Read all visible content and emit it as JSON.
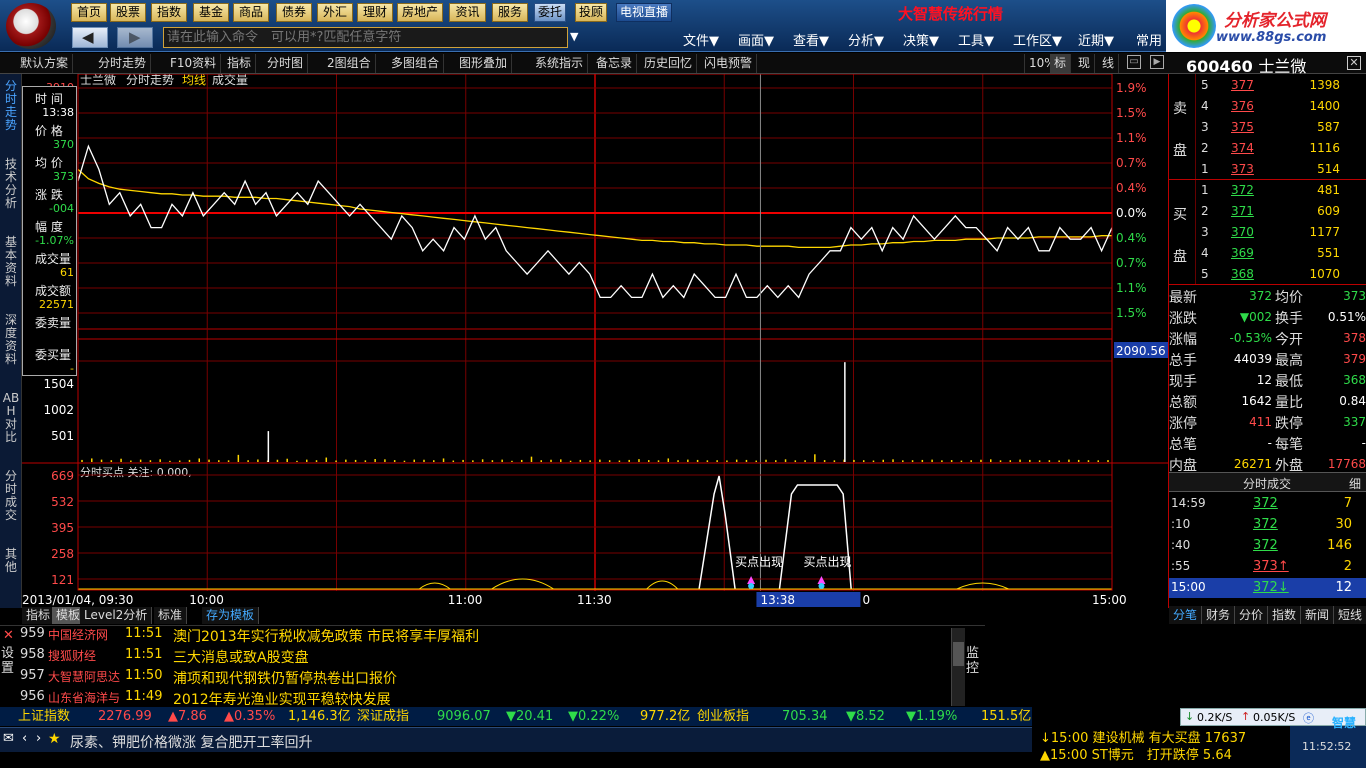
{
  "nav": {
    "buttons": [
      "首页",
      "股票",
      "指数",
      "基金",
      "商品",
      "债券",
      "外汇",
      "理财",
      "房地产",
      "资讯",
      "服务",
      "委托",
      "投顾",
      "电视直播"
    ],
    "brand": "大智慧传统行情",
    "command_placeholder": "请在此输入命令　可以用*?匹配任意字符",
    "menus": [
      "文件▼",
      "画面▼",
      "查看▼",
      "分析▼",
      "决策▼",
      "工具▼",
      "工作区▼",
      "近期▼",
      "常用"
    ],
    "site_logo_title": "分析家公式网",
    "site_logo_url": "www.88gs.com"
  },
  "toolbar": {
    "tabs": [
      "默认方案",
      "分时走势",
      "F10资料",
      "指标",
      "分时图",
      "2图组合",
      "多图组合",
      "图形叠加",
      "系统指示",
      "备忘录",
      "历史回忆",
      "闪电预警"
    ],
    "zoom": "10%",
    "modes": [
      "标",
      "现",
      "线"
    ]
  },
  "stock": {
    "code": "600460",
    "name": "士兰微"
  },
  "left_tabs": [
    "分时走势",
    "技术分析",
    "基本资料",
    "深度资料",
    "ABH对比",
    "分时成交",
    "其他"
  ],
  "chart_header": {
    "name": "士兰微",
    "items": [
      "分时走势",
      "均线",
      "成交量"
    ]
  },
  "info_box": {
    "rows": [
      {
        "label": "时 间",
        "value": "13:38",
        "color": "white"
      },
      {
        "label": "价 格",
        "value": "370",
        "color": "green"
      },
      {
        "label": "均 价",
        "value": "373",
        "color": "green"
      },
      {
        "label": "涨 跌",
        "value": "-004",
        "color": "green"
      },
      {
        "label": "幅 度",
        "value": "-1.07%",
        "color": "green"
      },
      {
        "label": "成交量",
        "value": "61",
        "color": "yellow"
      },
      {
        "label": "成交额",
        "value": "22571",
        "color": "yellow"
      },
      {
        "label": "委卖量",
        "value": "",
        "color": "yellow"
      },
      {
        "label": "委买量",
        "value": "-",
        "color": "yellow"
      }
    ]
  },
  "chart_data": [
    {
      "type": "line",
      "title": "",
      "series": [
        {
          "name": "",
          "values": [
            376,
            379,
            377,
            374,
            375,
            373,
            374,
            372,
            372,
            374,
            373,
            375,
            373,
            374,
            375,
            374,
            376,
            374,
            375,
            373,
            374,
            375,
            374,
            376,
            375,
            374,
            373,
            374,
            373,
            372,
            371,
            373,
            372,
            370,
            371,
            370,
            372,
            371,
            373,
            371,
            372,
            370,
            369,
            368,
            369,
            370,
            369,
            368,
            369,
            368,
            366,
            366,
            367,
            366,
            366,
            368,
            366,
            367,
            366,
            368,
            367,
            366,
            366,
            368,
            366,
            366,
            367,
            366,
            367,
            366,
            368,
            369,
            370,
            370,
            372,
            371,
            372,
            370,
            372,
            371,
            373,
            372,
            371,
            372,
            373,
            372,
            372,
            371,
            370,
            372,
            371,
            372,
            370,
            370,
            372,
            371,
            371,
            372,
            370,
            372
          ]
        },
        {
          "name": "",
          "values": [
            377,
            376.2,
            375.8,
            375.5,
            375.3,
            375.2,
            375.1,
            375,
            374.9,
            374.9,
            374.8,
            374.8,
            374.7,
            374.7,
            374.7,
            374.6,
            374.6,
            374.6,
            374.5,
            374.5,
            374.4,
            374.3,
            374.2,
            374.1,
            374,
            373.9,
            373.8,
            373.6,
            373.5,
            373.4,
            373.3,
            373.2,
            373.1,
            373,
            372.9,
            372.8,
            372.7,
            372.6,
            372.5,
            372.4,
            372.3,
            372.2,
            372.1,
            372,
            371.9,
            371.8,
            371.7,
            371.6,
            371.5,
            371.4,
            371.3,
            371.2,
            371.1,
            371,
            370.9,
            370.9,
            370.8,
            370.8,
            370.7,
            370.7,
            370.6,
            370.6,
            370.5,
            370.5,
            370.5,
            370.4,
            370.4,
            370.4,
            370.4,
            370.3,
            370.3,
            370.3,
            370.3,
            370.4,
            370.5,
            370.5,
            370.6,
            370.6,
            370.7,
            370.7,
            370.8,
            370.8,
            370.9,
            370.9,
            370.9,
            371,
            371,
            371,
            371.1,
            371.1,
            371.1,
            371.1,
            371.2,
            371.2,
            371.2,
            371.2,
            371.2,
            371.2,
            371.3,
            371.3
          ]
        }
      ],
      "ylim": [
        365,
        384
      ],
      "right_axis_labels": [
        "1.9%",
        "1.5%",
        "1.1%",
        "0.7%",
        "0.4%",
        "0.0%",
        "0.4%",
        "0.7%",
        "1.1%",
        "1.5%"
      ],
      "left_axis_top": "3910",
      "cursor_value": "2090.56"
    },
    {
      "type": "bar",
      "title": "",
      "ylabels": [
        "1504",
        "1002",
        "501"
      ],
      "values": [
        35,
        60,
        40,
        30,
        55,
        25,
        40,
        30,
        45,
        20,
        25,
        35,
        60,
        40,
        30,
        28,
        120,
        30,
        42,
        25,
        38,
        55,
        20,
        40,
        30,
        75,
        25,
        40,
        35,
        28,
        50,
        45,
        32,
        22,
        40,
        38,
        30,
        60,
        25,
        35,
        28,
        45,
        30,
        40,
        20,
        35,
        90,
        30,
        38,
        44,
        22,
        35,
        28,
        40,
        30,
        25,
        35,
        48,
        32,
        28,
        60,
        30,
        40,
        35,
        28,
        30,
        26,
        40,
        35,
        24,
        38,
        30,
        45,
        28,
        30,
        130,
        32,
        28,
        40,
        35,
        30,
        25,
        38,
        45,
        28,
        30,
        35,
        40,
        28,
        32,
        24,
        30,
        38,
        45,
        28,
        30,
        40,
        35,
        28,
        30,
        26,
        40,
        35,
        30,
        28,
        32
      ],
      "spikes": [
        {
          "index": 75,
          "value": 1680
        },
        {
          "index": 16,
          "value": 520
        }
      ]
    },
    {
      "type": "area",
      "title": "",
      "legend": "分时买点 关注: 0.000,",
      "ylabels": [
        "669",
        "532",
        "395",
        "258",
        "121"
      ],
      "annotations": [
        "买点出现",
        "买点出现"
      ]
    }
  ],
  "time_axis": {
    "start": "2013/01/04, 09:30",
    "labels": [
      "10:00",
      "11:00",
      "11:30",
      "15:00"
    ],
    "cursor": "13:38",
    "cursor_value": "0"
  },
  "bottom_tabs": [
    "指标",
    "模板",
    "Level2分析",
    "标准",
    "存为模板"
  ],
  "order_book": {
    "sell_label": [
      "卖",
      "盘"
    ],
    "buy_label": [
      "买",
      "盘"
    ],
    "sell": [
      {
        "n": "5",
        "p": "377",
        "v": "1398"
      },
      {
        "n": "4",
        "p": "376",
        "v": "1400"
      },
      {
        "n": "3",
        "p": "375",
        "v": "587"
      },
      {
        "n": "2",
        "p": "374",
        "v": "1116"
      },
      {
        "n": "1",
        "p": "373",
        "v": "514"
      }
    ],
    "buy": [
      {
        "n": "1",
        "p": "372",
        "v": "481"
      },
      {
        "n": "2",
        "p": "371",
        "v": "609"
      },
      {
        "n": "3",
        "p": "370",
        "v": "1177"
      },
      {
        "n": "4",
        "p": "369",
        "v": "551"
      },
      {
        "n": "5",
        "p": "368",
        "v": "1070"
      }
    ]
  },
  "stats": [
    {
      "l1": "最新",
      "v1": "372",
      "c1": "green",
      "l2": "均价",
      "v2": "373",
      "c2": "green"
    },
    {
      "l1": "涨跌",
      "v1": "▼002",
      "c1": "green",
      "l2": "换手",
      "v2": "0.51%",
      "c2": "white"
    },
    {
      "l1": "涨幅",
      "v1": "-0.53%",
      "c1": "green",
      "l2": "今开",
      "v2": "378",
      "c2": "red"
    },
    {
      "l1": "总手",
      "v1": "44039",
      "c1": "white",
      "l2": "最高",
      "v2": "379",
      "c2": "red"
    },
    {
      "l1": "现手",
      "v1": "12",
      "c1": "white",
      "l2": "最低",
      "v2": "368",
      "c2": "green"
    },
    {
      "l1": "总额",
      "v1": "1642",
      "c1": "white",
      "l2": "量比",
      "v2": "0.84",
      "c2": "white"
    },
    {
      "l1": "涨停",
      "v1": "411",
      "c1": "red",
      "l2": "跌停",
      "v2": "337",
      "c2": "green"
    },
    {
      "l1": "总笔",
      "v1": "-",
      "c1": "white",
      "l2": "每笔",
      "v2": "-",
      "c2": "white"
    },
    {
      "l1": "内盘",
      "v1": "26271",
      "c1": "yellow",
      "l2": "外盘",
      "v2": "17768",
      "c2": "red"
    }
  ],
  "ticks": {
    "title": "分时成交",
    "detail": "细",
    "rows": [
      {
        "t": "14:59",
        "p": "372",
        "v": "7"
      },
      {
        "t": ":10",
        "p": "372",
        "v": "30"
      },
      {
        "t": ":40",
        "p": "372",
        "v": "146"
      },
      {
        "t": ":55",
        "p": "373↑",
        "v": "2"
      },
      {
        "t": "15:00",
        "p": "372↓",
        "v": "12"
      }
    ]
  },
  "right_tabs": [
    "分笔",
    "财务",
    "分价",
    "指数",
    "新闻",
    "短线"
  ],
  "news": {
    "setting": "设置",
    "monitor": "监控",
    "rows": [
      {
        "no": "959",
        "src": "中国经济网",
        "time": "11:51",
        "title": "澳门2013年实行税收减免政策 市民将享丰厚福利"
      },
      {
        "no": "958",
        "src": "搜狐财经",
        "time": "11:51",
        "title": "三大消息或致A股变盘"
      },
      {
        "no": "957",
        "src": "大智慧阿思达",
        "time": "11:50",
        "title": "浦项和现代钢铁仍暂停热卷出口报价"
      },
      {
        "no": "956",
        "src": "山东省海洋与",
        "time": "11:49",
        "title": "2012年寿光渔业实现平稳较快发展"
      }
    ]
  },
  "index_bar": [
    {
      "t": "上证指数",
      "c": "#ffd700"
    },
    {
      "t": "2276.99",
      "c": "#ff4a4a"
    },
    {
      "t": "▲7.86",
      "c": "#ff4a4a"
    },
    {
      "t": "▲0.35%",
      "c": "#ff4a4a"
    },
    {
      "t": "1,146.3亿",
      "c": "#ffd700"
    },
    {
      "t": "深证成指",
      "c": "#ffd700"
    },
    {
      "t": "9096.07",
      "c": "#2fdc4a"
    },
    {
      "t": "▼20.41",
      "c": "#2fdc4a"
    },
    {
      "t": "▼0.22%",
      "c": "#2fdc4a"
    },
    {
      "t": "977.2亿",
      "c": "#ffd700"
    },
    {
      "t": "创业板指",
      "c": "#ffd700"
    },
    {
      "t": "705.34",
      "c": "#2fdc4a"
    },
    {
      "t": "▼8.52",
      "c": "#2fdc4a"
    },
    {
      "t": "▼1.19%",
      "c": "#2fdc4a"
    },
    {
      "t": "151.5亿",
      "c": "#ffd700"
    }
  ],
  "marquee": "尿素、钾肥价格微涨 复合肥开工率回升",
  "alerts": [
    {
      "t": "↓15:00 建设机械 有大买盘 17637",
      "c": "#ffd700"
    },
    {
      "t": "▲15:00 ST博元　打开跌停 5.64",
      "c": "#ffd700"
    }
  ],
  "net": {
    "down": "0.2K/S",
    "up": "0.05K/S",
    "clock": "11:52:52",
    "brand": "智慧"
  }
}
